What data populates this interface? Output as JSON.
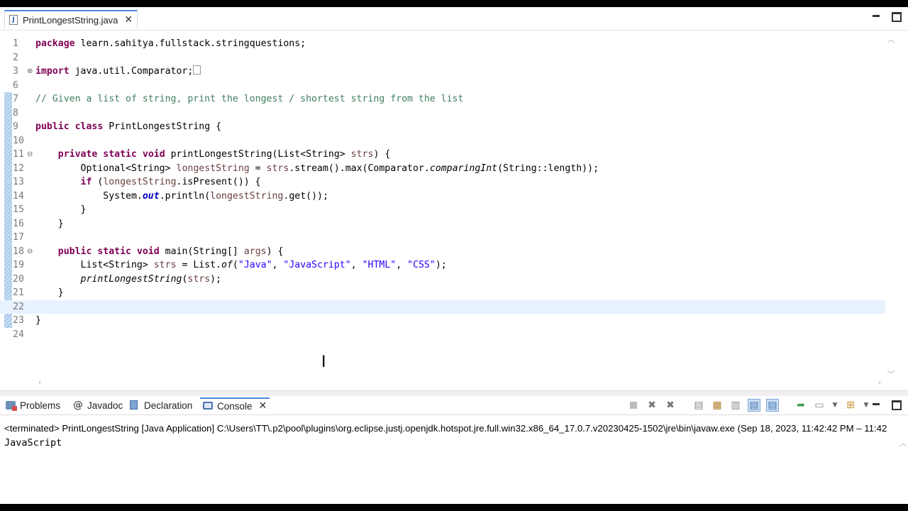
{
  "editor_tab": {
    "filename": "PrintLongestString.java",
    "close_glyph": "✕"
  },
  "code_lines": [
    {
      "num": "1",
      "segments": [
        {
          "t": "package",
          "c": "kw"
        },
        {
          "t": " learn.sahitya.fullstack.stringquestions;"
        }
      ]
    },
    {
      "num": "2",
      "segments": []
    },
    {
      "num": "3",
      "fold": "⊕",
      "segments": [
        {
          "t": "import",
          "c": "kw"
        },
        {
          "t": " java.util.Comparator;"
        },
        {
          "box": true
        }
      ]
    },
    {
      "num": "6",
      "segments": []
    },
    {
      "num": "7",
      "segments": [
        {
          "t": "// Given a list of string, print the longest / shortest string from the list",
          "c": "cm"
        }
      ]
    },
    {
      "num": "8",
      "segments": []
    },
    {
      "num": "9",
      "segments": [
        {
          "t": "public",
          "c": "kw"
        },
        {
          "t": " "
        },
        {
          "t": "class",
          "c": "kw"
        },
        {
          "t": " PrintLongestString {"
        }
      ]
    },
    {
      "num": "10",
      "segments": []
    },
    {
      "num": "11",
      "fold": "⊖",
      "segments": [
        {
          "t": "    "
        },
        {
          "t": "private",
          "c": "kw"
        },
        {
          "t": " "
        },
        {
          "t": "static",
          "c": "kw"
        },
        {
          "t": " "
        },
        {
          "t": "void",
          "c": "kw"
        },
        {
          "t": " printLongestString(List<String> "
        },
        {
          "t": "strs",
          "c": "var"
        },
        {
          "t": ") {"
        }
      ]
    },
    {
      "num": "12",
      "segments": [
        {
          "t": "        Optional<String> "
        },
        {
          "t": "longestString",
          "c": "var"
        },
        {
          "t": " = "
        },
        {
          "t": "strs",
          "c": "var"
        },
        {
          "t": ".stream().max(Comparator."
        },
        {
          "t": "comparingInt",
          "c": "it"
        },
        {
          "t": "(String::length));"
        }
      ]
    },
    {
      "num": "13",
      "segments": [
        {
          "t": "        "
        },
        {
          "t": "if",
          "c": "kw"
        },
        {
          "t": " ("
        },
        {
          "t": "longestString",
          "c": "var"
        },
        {
          "t": ".isPresent()) {"
        }
      ]
    },
    {
      "num": "14",
      "segments": [
        {
          "t": "            System."
        },
        {
          "t": "out",
          "c": "fld"
        },
        {
          "t": ".println("
        },
        {
          "t": "longestString",
          "c": "var"
        },
        {
          "t": ".get());"
        }
      ]
    },
    {
      "num": "15",
      "segments": [
        {
          "t": "        }"
        }
      ]
    },
    {
      "num": "16",
      "segments": [
        {
          "t": "    }"
        }
      ]
    },
    {
      "num": "17",
      "segments": []
    },
    {
      "num": "18",
      "fold": "⊖",
      "segments": [
        {
          "t": "    "
        },
        {
          "t": "public",
          "c": "kw"
        },
        {
          "t": " "
        },
        {
          "t": "static",
          "c": "kw"
        },
        {
          "t": " "
        },
        {
          "t": "void",
          "c": "kw"
        },
        {
          "t": " main(String[] "
        },
        {
          "t": "args",
          "c": "var"
        },
        {
          "t": ") {"
        }
      ]
    },
    {
      "num": "19",
      "segments": [
        {
          "t": "        List<String> "
        },
        {
          "t": "strs",
          "c": "var"
        },
        {
          "t": " = List."
        },
        {
          "t": "of",
          "c": "it"
        },
        {
          "t": "("
        },
        {
          "t": "\"Java\"",
          "c": "str"
        },
        {
          "t": ", "
        },
        {
          "t": "\"JavaScript\"",
          "c": "str"
        },
        {
          "t": ", "
        },
        {
          "t": "\"HTML\"",
          "c": "str"
        },
        {
          "t": ", "
        },
        {
          "t": "\"CSS\"",
          "c": "str"
        },
        {
          "t": ");"
        }
      ]
    },
    {
      "num": "20",
      "segments": [
        {
          "t": "        "
        },
        {
          "t": "printLongestString",
          "c": "it"
        },
        {
          "t": "("
        },
        {
          "t": "strs",
          "c": "var"
        },
        {
          "t": ");"
        }
      ]
    },
    {
      "num": "21",
      "segments": [
        {
          "t": "    }"
        }
      ]
    },
    {
      "num": "22",
      "current": true,
      "segments": []
    },
    {
      "num": "23",
      "segments": [
        {
          "t": "}"
        }
      ]
    },
    {
      "num": "24",
      "segments": []
    }
  ],
  "panel_tabs": [
    {
      "id": "problems",
      "label": "Problems",
      "icon": "problems-icon"
    },
    {
      "id": "javadoc",
      "label": "Javadoc",
      "icon": "javadoc-icon",
      "glyph": "@"
    },
    {
      "id": "declaration",
      "label": "Declaration",
      "icon": "declaration-icon"
    },
    {
      "id": "console",
      "label": "Console",
      "icon": "console-icon",
      "active": true
    }
  ],
  "toolbar_icons": [
    "terminate-icon",
    "remove-launch-icon",
    "remove-all-terminated-icon",
    "separator",
    "scroll-lock-icon",
    "word-wrap-icon",
    "show-on-output-icon",
    "show-console-stdout-icon",
    "show-console-stderr-icon",
    "separator",
    "pin-console-icon",
    "display-selected-console-icon",
    "display-dropdown-icon",
    "open-console-icon",
    "open-dropdown-icon"
  ],
  "console": {
    "status": "<terminated> PrintLongestString [Java Application] C:\\Users\\TT\\.p2\\pool\\plugins\\org.eclipse.justj.openjdk.hotspot.jre.full.win32.x86_64_17.0.7.v20230425-1502\\jre\\bin\\javaw.exe  (Sep 18, 2023, 11:42:42 PM – 11:42",
    "output": "JavaScript"
  }
}
